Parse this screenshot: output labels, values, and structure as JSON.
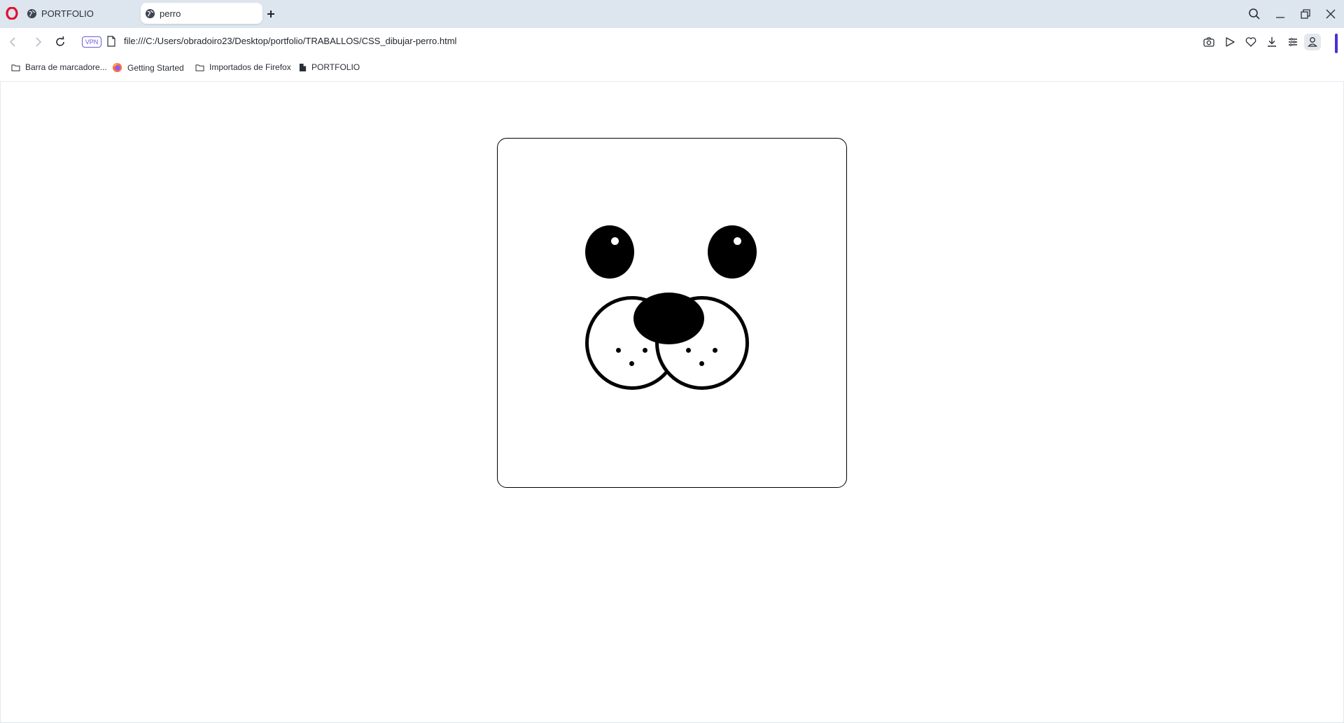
{
  "browser": {
    "logo": "opera-logo",
    "tabs": [
      {
        "label": "PORTFOLIO",
        "icon": "globe-icon",
        "active": false
      },
      {
        "label": "perro",
        "icon": "globe-icon",
        "active": true
      }
    ],
    "vpn_badge": "VPN",
    "url": "file:///C:/Users/obradoiro23/Desktop/portfolio/TRABALLOS/CSS_dibujar-perro.html",
    "accent_color": "#4b2fd6"
  },
  "bookmarks": [
    {
      "label": "Barra de marcadore...",
      "icon": "folder-icon"
    },
    {
      "label": "Getting Started",
      "icon": "firefox-icon"
    },
    {
      "label": "Importados de Firefox",
      "icon": "folder-icon"
    },
    {
      "label": "PORTFOLIO",
      "icon": "file-icon"
    }
  ],
  "drawing": {
    "subject": "dog-face",
    "colors": {
      "ink": "#000000",
      "background": "#ffffff"
    }
  }
}
